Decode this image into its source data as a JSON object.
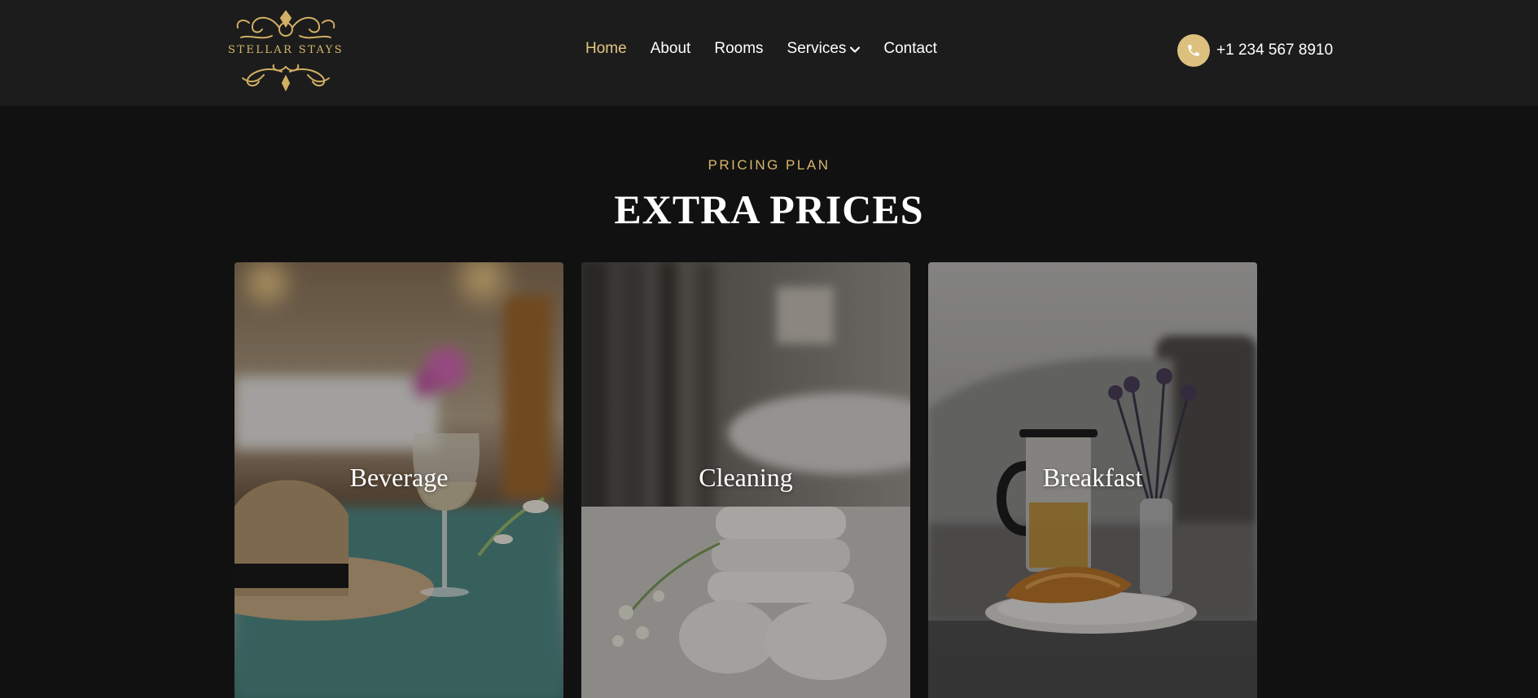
{
  "brand": {
    "logo_text": "STELLAR STAYS",
    "accent_color": "#d8b76a"
  },
  "nav": {
    "items": [
      {
        "label": "Home",
        "active": true
      },
      {
        "label": "About"
      },
      {
        "label": "Rooms"
      },
      {
        "label": "Services",
        "has_dropdown": true
      },
      {
        "label": "Contact"
      }
    ]
  },
  "contact": {
    "phone_icon": "phone-icon",
    "phone_number": "+1 234 567 8910"
  },
  "section": {
    "eyebrow": "PRICING PLAN",
    "title": "EXTRA PRICES"
  },
  "cards": [
    {
      "title": "Beverage",
      "image": "beverage-photo"
    },
    {
      "title": "Cleaning",
      "image": "cleaning-photo"
    },
    {
      "title": "Breakfast",
      "image": "breakfast-photo"
    }
  ]
}
